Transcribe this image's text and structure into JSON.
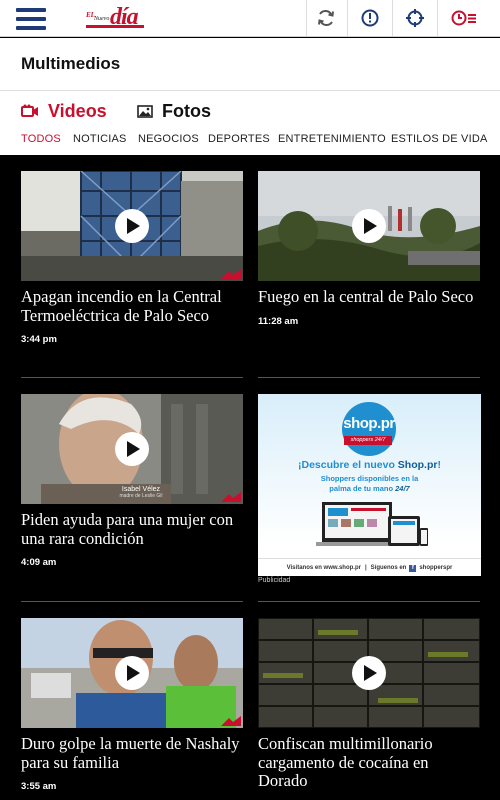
{
  "header": {
    "logo": {
      "el": "EL",
      "nuevo": "Nuevo",
      "dia": "día"
    },
    "icons": [
      "menu-icon",
      "refresh-icon",
      "info-icon",
      "crosshair-icon",
      "clock-list-icon"
    ]
  },
  "section": {
    "title": "Multimedios"
  },
  "media_tabs": [
    {
      "label": "Videos",
      "icon": "video-camera-icon",
      "active": true
    },
    {
      "label": "Fotos",
      "icon": "image-icon",
      "active": false
    }
  ],
  "categories": [
    "TODOS",
    "NOTICIAS",
    "NEGOCIOS",
    "DEPORTES",
    "ENTRETENIMIENTO",
    "ESTILOS DE VIDA"
  ],
  "videos": [
    {
      "title": "Apagan incendio en la Central Termoeléctrica de Palo Seco",
      "time": "3:44 pm"
    },
    {
      "title": "Fuego en la central de Palo Seco",
      "time": "11:28 am"
    },
    {
      "title": "Piden ayuda para una mujer con una rara condición",
      "time": "4:09 am",
      "caption_name": "Isabel Vélez",
      "caption_sub": "madre de Leslie Gil"
    },
    {
      "title": "Duro golpe la muerte de Nashaly para su familia",
      "time": "3:55 am"
    },
    {
      "title": "Confiscan multimillonario cargamento de cocaína en Dorado",
      "time": ""
    }
  ],
  "ad": {
    "label": "Publicidad",
    "logo_text": "shop.pr",
    "logo_badge": "shoppers 24/7",
    "headline_pre": "¡Descubre el nuevo ",
    "headline_brand": "Shop.pr",
    "headline_post": "!",
    "sub1": "Shoppers disponibles en la",
    "sub2_pre": "palma de tu mano ",
    "sub2_emph": "24/7",
    "footer_left": "Visítanos en www.shop.pr",
    "footer_sep": "|",
    "footer_right_pre": "Síguenos en",
    "footer_right": "shopperspr"
  },
  "colors": {
    "accent": "#c8102e",
    "nav_blue": "#1e3a78",
    "ad_blue": "#1f8fd0"
  }
}
